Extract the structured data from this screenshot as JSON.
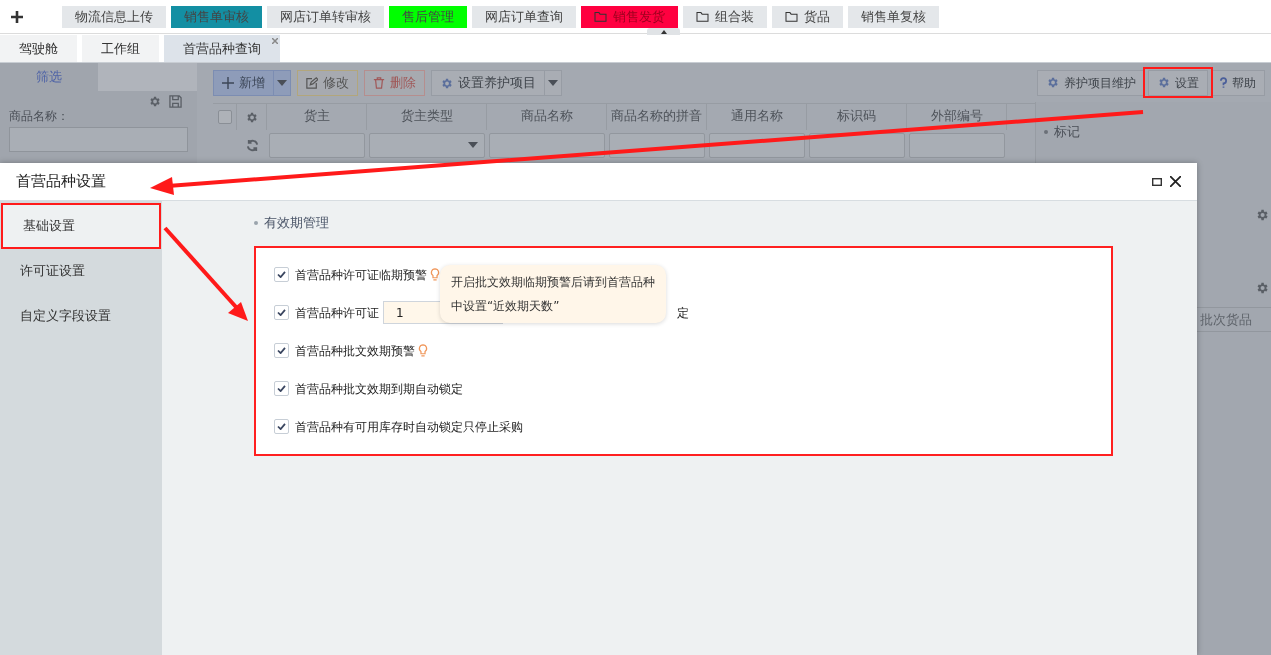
{
  "top_tabs": [
    {
      "label": "物流信息上传",
      "color": "#e4e7ea",
      "kind": "plain"
    },
    {
      "label": "销售单审核",
      "color": "#138fa3",
      "kind": "plain"
    },
    {
      "label": "网店订单转审核",
      "color": "#e4e7ea",
      "kind": "plain"
    },
    {
      "label": "售后管理",
      "color": "#00ff00",
      "kind": "plain"
    },
    {
      "label": "网店订单查询",
      "color": "#e4e7ea",
      "kind": "plain"
    },
    {
      "label": "销售发货",
      "color": "#ff0040",
      "kind": "folder"
    },
    {
      "label": "组合装",
      "color": "#e4e7ea",
      "kind": "folder"
    },
    {
      "label": "货品",
      "color": "#e4e7ea",
      "kind": "folder"
    },
    {
      "label": "销售单复核",
      "color": "#e4e7ea",
      "kind": "plain"
    }
  ],
  "page_tabs": [
    {
      "label": "驾驶舱",
      "selected": false
    },
    {
      "label": "工作组",
      "selected": false
    },
    {
      "label": "首营品种查询",
      "selected": true
    }
  ],
  "filter_panel": {
    "tab": "筛选",
    "fields": [
      {
        "label": "商品名称："
      }
    ]
  },
  "toolbar": [
    {
      "label": "新增",
      "kind": "primary",
      "dropdown": true
    },
    {
      "label": "修改",
      "kind": "edit",
      "dropdown": false
    },
    {
      "label": "删除",
      "kind": "delete",
      "dropdown": false
    },
    {
      "label": "设置养护项目",
      "kind": "gear",
      "dropdown": true
    }
  ],
  "right_toolbar": [
    {
      "label": "养护项目维护",
      "kind": "gear"
    },
    {
      "label": "设置",
      "kind": "gear"
    },
    {
      "label": "帮助",
      "kind": "help"
    }
  ],
  "table": {
    "select_all": {
      "checked": false
    },
    "columns": [
      {
        "label": "货主",
        "kind": "text"
      },
      {
        "label": "货主类型",
        "kind": "select"
      },
      {
        "label": "商品名称",
        "kind": "text"
      },
      {
        "label": "商品名称的拼音",
        "kind": "text"
      },
      {
        "label": "通用名称",
        "kind": "text"
      },
      {
        "label": "标识码",
        "kind": "text"
      },
      {
        "label": "外部编号",
        "kind": "text"
      }
    ]
  },
  "right_panel": {
    "title": "标记",
    "label": "批次货品"
  },
  "dialog": {
    "title": "首营品种设置",
    "nav": [
      {
        "label": "基础设置",
        "selected": true
      },
      {
        "label": "许可证设置",
        "selected": false
      },
      {
        "label": "自定义字段设置",
        "selected": false
      }
    ],
    "section": "有效期管理",
    "options": [
      {
        "kind": "hint",
        "label": "首营品种许可证临期预警",
        "checked": true
      },
      {
        "kind": "input",
        "label": "首营品种许可证",
        "value": "1",
        "suffix": "定",
        "checked": true
      },
      {
        "kind": "hint",
        "label": "首营品种批文效期预警",
        "checked": true
      },
      {
        "kind": "plain",
        "label": "首营品种批文效期到期自动锁定",
        "checked": true
      },
      {
        "kind": "plain",
        "label": "首营品种有可用库存时自动锁定只停止采购",
        "checked": true
      }
    ],
    "tooltip": "开启批文效期临期预警后请到首营品种中设置“近效期天数”"
  }
}
